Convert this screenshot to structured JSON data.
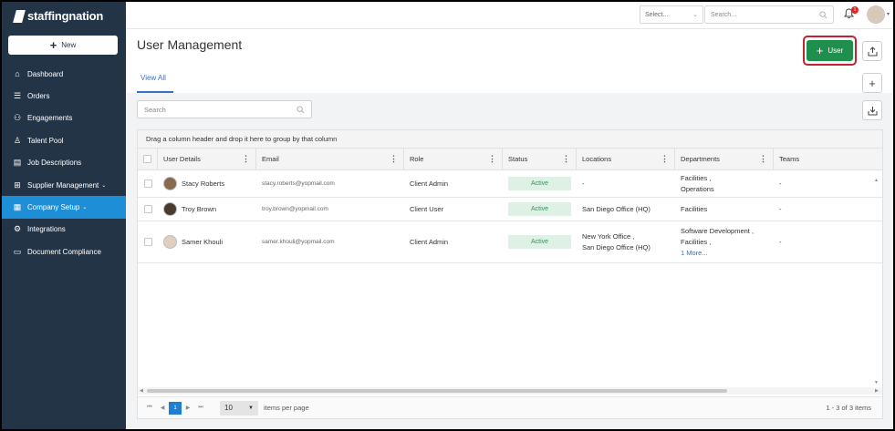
{
  "app": {
    "logo": "staffingnation"
  },
  "sidebar": {
    "new_label": "New",
    "items": [
      {
        "label": "Dashboard",
        "icon": "home-icon"
      },
      {
        "label": "Orders",
        "icon": "list-icon"
      },
      {
        "label": "Engagements",
        "icon": "people-icon"
      },
      {
        "label": "Talent Pool",
        "icon": "person-icon"
      },
      {
        "label": "Job Descriptions",
        "icon": "document-icon"
      },
      {
        "label": "Supplier Management",
        "icon": "hierarchy-icon"
      },
      {
        "label": "Company Setup",
        "icon": "building-icon"
      },
      {
        "label": "Integrations",
        "icon": "gear-icon"
      },
      {
        "label": "Document Compliance",
        "icon": "folder-icon"
      }
    ]
  },
  "topbar": {
    "select_placeholder": "Select...",
    "search_placeholder": "Search...",
    "notification_count": "1"
  },
  "page": {
    "title": "User Management",
    "add_user_label": "User",
    "tab": "View All",
    "search_placeholder": "Search",
    "group_hint": "Drag a column header and drop it here to group by that column"
  },
  "grid": {
    "columns": [
      "User Details",
      "Email",
      "Role",
      "Status",
      "Locations",
      "Departments",
      "Teams"
    ],
    "rows": [
      {
        "name": "Stacy Roberts",
        "email": "stacy.roberts@yopmail.com",
        "role": "Client Admin",
        "status": "Active",
        "locations": [
          "-"
        ],
        "departments": [
          "Facilities ,",
          "Operations"
        ],
        "more": "",
        "teams": "-"
      },
      {
        "name": "Troy Brown",
        "email": "troy.brown@yopmail.com",
        "role": "Client User",
        "status": "Active",
        "locations": [
          "San Diego Office (HQ)"
        ],
        "departments": [
          "Facilities"
        ],
        "more": "",
        "teams": "-"
      },
      {
        "name": "Samer Khouli",
        "email": "samer.khouli@yopmail.com",
        "role": "Client Admin",
        "status": "Active",
        "locations": [
          "New York Office ,",
          "San Diego Office (HQ)"
        ],
        "departments": [
          "Software Development ,",
          "Facilities ,"
        ],
        "more": "1 More...",
        "teams": "-"
      }
    ]
  },
  "pager": {
    "current_page": "1",
    "page_size": "10",
    "per_page_label": "items per page",
    "count_label": "1 - 3 of 3 items"
  },
  "colors": {
    "sidebar_bg": "#243447",
    "active_nav": "#1e8fd6",
    "primary_button": "#1f8f4e",
    "highlight_ring": "#c0252b",
    "status_active_bg": "#dff1e5",
    "status_active_text": "#2f9557"
  }
}
